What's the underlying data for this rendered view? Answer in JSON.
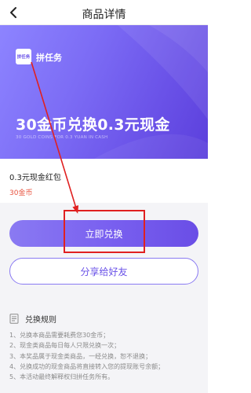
{
  "header": {
    "title": "商品详情",
    "back_icon": "back-arrow-icon"
  },
  "banner": {
    "logo_text": "拼任务",
    "brand": "拼任务",
    "title": "30金币兑换0.3元现金",
    "subtitle": "30 GOLD COINS FOR 0.3 YUAN IN CASH",
    "colors": {
      "start": "#8d84ff",
      "end": "#5b3fdc"
    }
  },
  "product": {
    "name": "0.3元现金红包",
    "price": "30金币",
    "price_color": "#e8533f"
  },
  "actions": {
    "redeem_label": "立即兑换",
    "share_label": "分享给好友",
    "accent": "#7a61f0"
  },
  "rules": {
    "icon": "document-icon",
    "title": "兑换规则",
    "items": [
      "1、兑换本商品需要耗费您30金币；",
      "2、现金类商品每日每人只限兑换一次；",
      "3、本奖品属于现金类商品，一经兑换，恕不退换；",
      "4、兑换成功的现金商品将直接转入您的提现账号余额；",
      "5、本活动最终解释权归拼任务所有。"
    ]
  },
  "annotation": {
    "color": "#e02020"
  }
}
